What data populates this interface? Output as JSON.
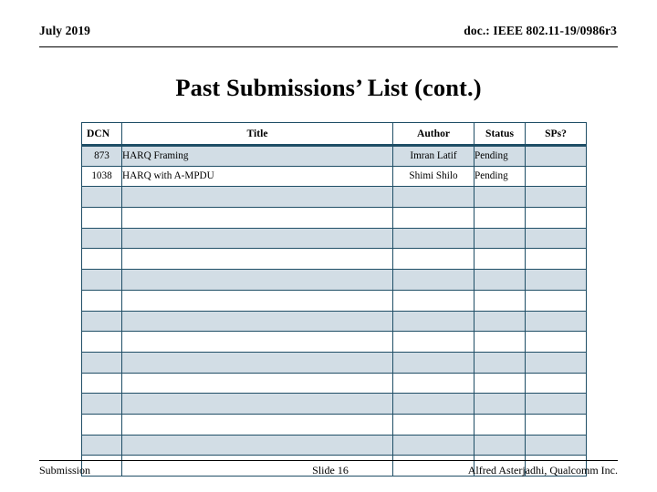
{
  "header": {
    "date": "July 2019",
    "doc": "doc.: IEEE 802.11-19/0986r3"
  },
  "title": "Past Submissions’ List (cont.)",
  "table": {
    "columns": [
      {
        "key": "dcn",
        "label": "DCN"
      },
      {
        "key": "title",
        "label": "Title"
      },
      {
        "key": "author",
        "label": "Author"
      },
      {
        "key": "status",
        "label": "Status"
      },
      {
        "key": "sps",
        "label": "SPs?"
      }
    ],
    "rows": [
      {
        "dcn": "873",
        "title": "HARQ Framing",
        "author": "Imran Latif",
        "status": "Pending",
        "sps": ""
      },
      {
        "dcn": "1038",
        "title": "HARQ with A-MPDU",
        "author": "Shimi Shilo",
        "status": "Pending",
        "sps": ""
      },
      {
        "dcn": "",
        "title": "",
        "author": "",
        "status": "",
        "sps": ""
      },
      {
        "dcn": "",
        "title": "",
        "author": "",
        "status": "",
        "sps": ""
      },
      {
        "dcn": "",
        "title": "",
        "author": "",
        "status": "",
        "sps": ""
      },
      {
        "dcn": "",
        "title": "",
        "author": "",
        "status": "",
        "sps": ""
      },
      {
        "dcn": "",
        "title": "",
        "author": "",
        "status": "",
        "sps": ""
      },
      {
        "dcn": "",
        "title": "",
        "author": "",
        "status": "",
        "sps": ""
      },
      {
        "dcn": "",
        "title": "",
        "author": "",
        "status": "",
        "sps": ""
      },
      {
        "dcn": "",
        "title": "",
        "author": "",
        "status": "",
        "sps": ""
      },
      {
        "dcn": "",
        "title": "",
        "author": "",
        "status": "",
        "sps": ""
      },
      {
        "dcn": "",
        "title": "",
        "author": "",
        "status": "",
        "sps": ""
      },
      {
        "dcn": "",
        "title": "",
        "author": "",
        "status": "",
        "sps": ""
      },
      {
        "dcn": "",
        "title": "",
        "author": "",
        "status": "",
        "sps": ""
      },
      {
        "dcn": "",
        "title": "",
        "author": "",
        "status": "",
        "sps": ""
      },
      {
        "dcn": "",
        "title": "",
        "author": "",
        "status": "",
        "sps": ""
      }
    ]
  },
  "footer": {
    "left": "Submission",
    "center": "Slide 16",
    "right": "Alfred Asterjadhi, Qualcomm Inc."
  },
  "colors": {
    "row_shade": "#d2dde5",
    "table_border": "#1f4e66",
    "rule": "#000000"
  }
}
